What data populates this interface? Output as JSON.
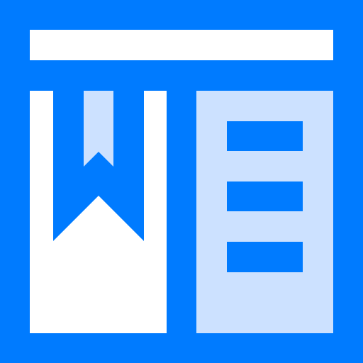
{
  "icon": {
    "name": "bookmark-document-window-icon",
    "colors": {
      "frame": "#007BFF",
      "white": "#FFFFFF",
      "light": "#CCE1FF"
    }
  }
}
